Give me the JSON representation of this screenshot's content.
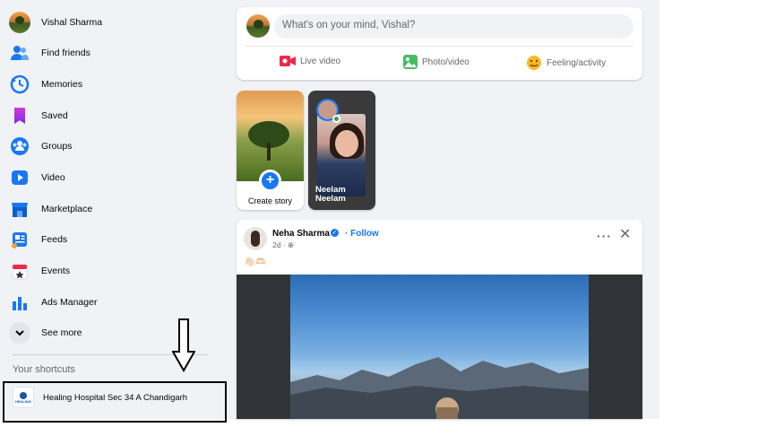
{
  "sidebar": {
    "profile_name": "Vishal Sharma",
    "items": [
      {
        "label": "Find friends",
        "icon": "friends-icon"
      },
      {
        "label": "Memories",
        "icon": "memories-icon"
      },
      {
        "label": "Saved",
        "icon": "saved-icon"
      },
      {
        "label": "Groups",
        "icon": "groups-icon"
      },
      {
        "label": "Video",
        "icon": "video-icon"
      },
      {
        "label": "Marketplace",
        "icon": "marketplace-icon"
      },
      {
        "label": "Feeds",
        "icon": "feeds-icon"
      },
      {
        "label": "Events",
        "icon": "events-icon"
      },
      {
        "label": "Ads Manager",
        "icon": "ads-manager-icon"
      }
    ],
    "see_more": "See more",
    "shortcuts_title": "Your shortcuts",
    "shortcuts": [
      {
        "label": "Healing Hospital Sec 34 A Chandigarh",
        "logo_text": "HEALING"
      }
    ]
  },
  "composer": {
    "placeholder": "What's on your mind, Vishal?",
    "actions": [
      {
        "label": "Live video",
        "icon": "live-video-icon",
        "color": "#f02849"
      },
      {
        "label": "Photo/video",
        "icon": "photo-video-icon",
        "color": "#45bd62"
      },
      {
        "label": "Feeling/activity",
        "icon": "feeling-icon",
        "color": "#f7b928"
      }
    ]
  },
  "stories": {
    "create_label": "Create story",
    "friend_story_name": "Neelam Neelam"
  },
  "post": {
    "author": "Neha Sharma",
    "follow": "Follow",
    "time": "2d",
    "emoji_text": "👋🏻🫶🏻"
  },
  "colors": {
    "brand_blue": "#1877f2",
    "background": "#f0f2f5",
    "online_green": "#31a24c"
  }
}
